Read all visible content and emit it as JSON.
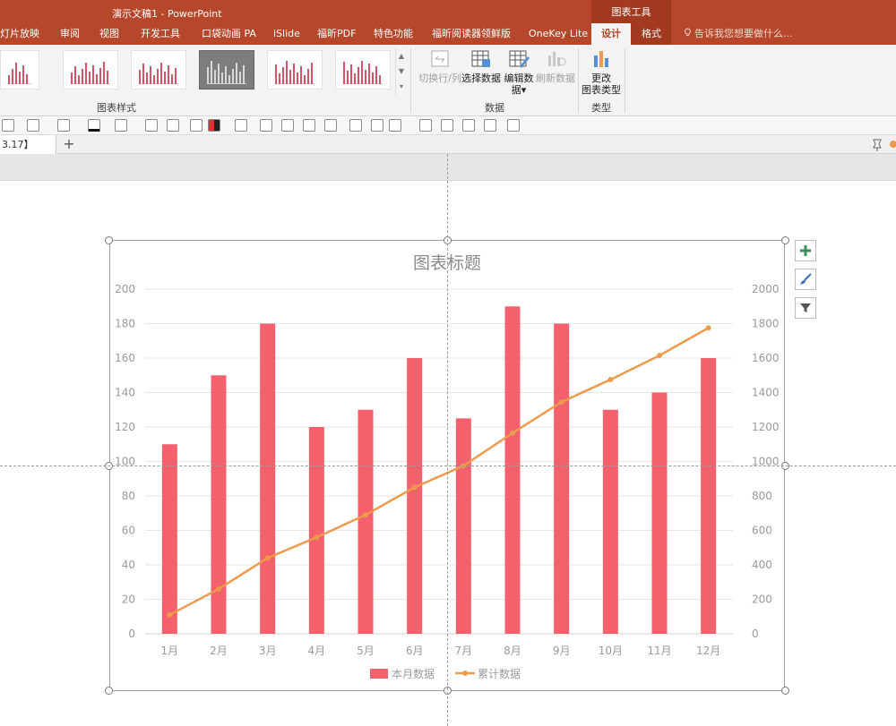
{
  "window": {
    "title": "演示文稿1 - PowerPoint",
    "context_tool_title": "图表工具"
  },
  "ribbon_tabs": {
    "items": [
      "灯片放映",
      "审阅",
      "视图",
      "开发工具",
      "口袋动画 PA",
      "iSlide",
      "福昕PDF",
      "特色功能",
      "福昕阅读器领鲜版",
      "OneKey Lite",
      "设计",
      "格式"
    ],
    "active": "设计",
    "tell_me": "告诉我您想要做什么..."
  },
  "ribbon": {
    "group_styles_label": "图表样式",
    "group_data_label": "数据",
    "group_type_label": "类型",
    "buttons": {
      "switch_row_col": "切换行/列",
      "select_data": "选择数据",
      "edit_data_line1": "编辑数",
      "edit_data_line2": "据",
      "refresh_data": "刷新数据",
      "change_type_line1": "更改",
      "change_type_line2": "图表类型"
    },
    "dropdown_arrow": "▾",
    "colors": {
      "titlebar": "#b7472a",
      "context_tab": "#a13a1f",
      "ribbon_bg": "#f3f3f3"
    }
  },
  "document_tab": {
    "label": "3.17】",
    "add_label": "+"
  },
  "chart_data": {
    "type": "bar",
    "title": "图表标题",
    "categories": [
      "1月",
      "2月",
      "3月",
      "4月",
      "5月",
      "6月",
      "7月",
      "8月",
      "9月",
      "10月",
      "11月",
      "12月"
    ],
    "series": [
      {
        "name": "本月数据",
        "type": "bar",
        "axis": "left",
        "color": "#f4606c",
        "values": [
          110,
          150,
          180,
          120,
          130,
          160,
          125,
          190,
          180,
          130,
          140,
          160
        ]
      },
      {
        "name": "累计数据",
        "type": "line",
        "axis": "right",
        "color": "#ee9a4d",
        "values": [
          110,
          260,
          440,
          560,
          690,
          850,
          975,
          1165,
          1345,
          1475,
          1615,
          1775
        ]
      }
    ],
    "y_left": {
      "min": 0,
      "max": 200,
      "ticks": [
        "0",
        "20",
        "40",
        "60",
        "80",
        "100",
        "120",
        "140",
        "160",
        "180",
        "200"
      ]
    },
    "y_right": {
      "min": 0,
      "max": 2000,
      "ticks": [
        "0",
        "200",
        "400",
        "600",
        "800",
        "1000",
        "1200",
        "1400",
        "1600",
        "1800",
        "2000"
      ]
    },
    "grid": true,
    "legend": "bottom"
  },
  "chart_side_buttons": [
    "plus-icon",
    "brush-icon",
    "filter-icon"
  ]
}
